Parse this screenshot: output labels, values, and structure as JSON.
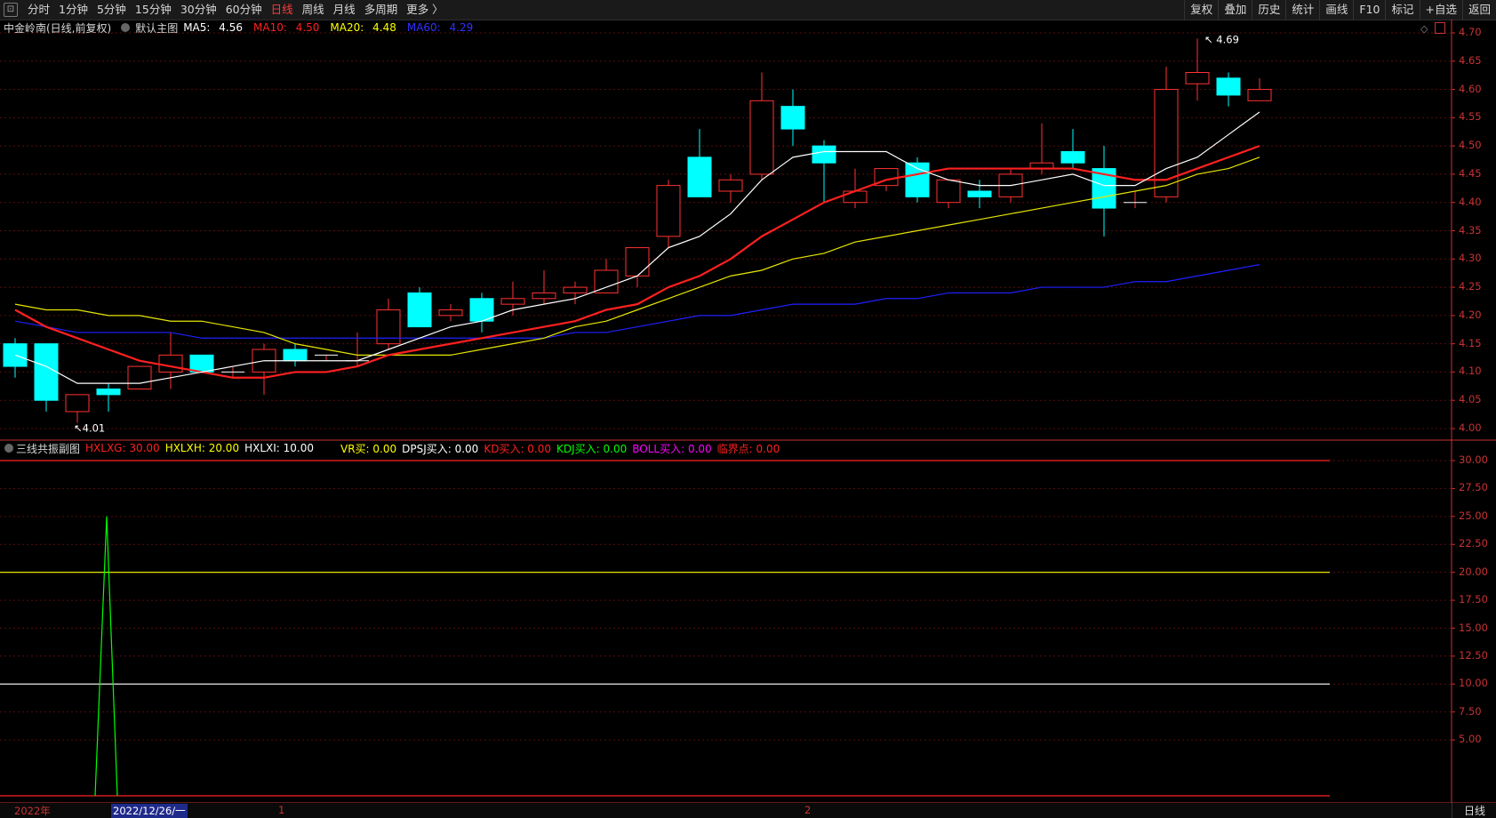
{
  "toolbar": {
    "periods": [
      "分时",
      "1分钟",
      "5分钟",
      "15分钟",
      "30分钟",
      "60分钟",
      "日线",
      "周线",
      "月线",
      "多周期",
      "更多 〉"
    ],
    "active_period": "日线",
    "tools": [
      "复权",
      "叠加",
      "历史",
      "统计",
      "画线",
      "F10",
      "标记",
      "+自选",
      "返回"
    ]
  },
  "main_chart": {
    "stock_name": "中金岭南(日线,前复权)",
    "template_name": "默认主图",
    "ma5": {
      "label": "MA5:",
      "value": "4.56",
      "color": "#ffffff"
    },
    "ma10": {
      "label": "MA10:",
      "value": "4.50",
      "color": "#ff2020"
    },
    "ma20": {
      "label": "MA20:",
      "value": "4.48",
      "color": "#ffff00"
    },
    "ma60": {
      "label": "MA60:",
      "value": "4.29",
      "color": "#2020ff"
    },
    "price_ticks": [
      "4.70",
      "4.65",
      "4.60",
      "4.55",
      "4.50",
      "4.45",
      "4.40",
      "4.35",
      "4.30",
      "4.25",
      "4.20",
      "4.15",
      "4.10",
      "4.05",
      "4.00"
    ],
    "high_label": "4.69",
    "low_label": "4.01"
  },
  "sub_chart": {
    "indicator_name": "三线共振副图",
    "legend": [
      {
        "label": "HXLXG:",
        "value": "30.00",
        "color": "#ff2020"
      },
      {
        "label": "HXLXH:",
        "value": "20.00",
        "color": "#ffff00"
      },
      {
        "label": "HXLXI:",
        "value": "10.00",
        "color": "#ffffff"
      },
      {
        "label": "VR买:",
        "value": "0.00",
        "color": "#ffff00"
      },
      {
        "label": "DPSJ买入:",
        "value": "0.00",
        "color": "#ffffff"
      },
      {
        "label": "KD买入:",
        "value": "0.00",
        "color": "#ff2020"
      },
      {
        "label": "KDJ买入:",
        "value": "0.00",
        "color": "#00ff00"
      },
      {
        "label": "BOLL买入:",
        "value": "0.00",
        "color": "#ff00ff"
      },
      {
        "label": "临界点:",
        "value": "0.00",
        "color": "#ff2020"
      }
    ],
    "ticks": [
      "30.00",
      "27.50",
      "25.00",
      "22.50",
      "20.00",
      "17.50",
      "15.00",
      "12.50",
      "10.00",
      "7.50",
      "5.00"
    ]
  },
  "bottom": {
    "year_label": "2022年",
    "selected_date": "2022/12/26/一",
    "month_1": "1",
    "month_2": "2",
    "period_tag": "日线"
  },
  "chart_data": [
    {
      "type": "candlestick",
      "title": "中金岭南(日线,前复权)",
      "ylim": [
        4.0,
        4.7
      ],
      "candles": [
        {
          "o": 4.15,
          "h": 4.16,
          "l": 4.09,
          "c": 4.11
        },
        {
          "o": 4.15,
          "h": 4.15,
          "l": 4.03,
          "c": 4.05
        },
        {
          "o": 4.03,
          "h": 4.06,
          "l": 4.01,
          "c": 4.06
        },
        {
          "o": 4.07,
          "h": 4.08,
          "l": 4.03,
          "c": 4.06
        },
        {
          "o": 4.07,
          "h": 4.11,
          "l": 4.07,
          "c": 4.11
        },
        {
          "o": 4.1,
          "h": 4.17,
          "l": 4.07,
          "c": 4.13
        },
        {
          "o": 4.13,
          "h": 4.13,
          "l": 4.1,
          "c": 4.1
        },
        {
          "o": 4.1,
          "h": 4.11,
          "l": 4.09,
          "c": 4.1
        },
        {
          "o": 4.1,
          "h": 4.15,
          "l": 4.06,
          "c": 4.14
        },
        {
          "o": 4.14,
          "h": 4.15,
          "l": 4.11,
          "c": 4.12
        },
        {
          "o": 4.13,
          "h": 4.13,
          "l": 4.12,
          "c": 4.13
        },
        {
          "o": 4.12,
          "h": 4.17,
          "l": 4.11,
          "c": 4.12
        },
        {
          "o": 4.15,
          "h": 4.23,
          "l": 4.14,
          "c": 4.21
        },
        {
          "o": 4.24,
          "h": 4.25,
          "l": 4.18,
          "c": 4.18
        },
        {
          "o": 4.2,
          "h": 4.22,
          "l": 4.19,
          "c": 4.21
        },
        {
          "o": 4.23,
          "h": 4.24,
          "l": 4.17,
          "c": 4.19
        },
        {
          "o": 4.22,
          "h": 4.26,
          "l": 4.2,
          "c": 4.23
        },
        {
          "o": 4.23,
          "h": 4.28,
          "l": 4.22,
          "c": 4.24
        },
        {
          "o": 4.24,
          "h": 4.26,
          "l": 4.22,
          "c": 4.25
        },
        {
          "o": 4.24,
          "h": 4.3,
          "l": 4.24,
          "c": 4.28
        },
        {
          "o": 4.27,
          "h": 4.32,
          "l": 4.25,
          "c": 4.32
        },
        {
          "o": 4.34,
          "h": 4.44,
          "l": 4.32,
          "c": 4.43
        },
        {
          "o": 4.48,
          "h": 4.53,
          "l": 4.41,
          "c": 4.41
        },
        {
          "o": 4.42,
          "h": 4.45,
          "l": 4.4,
          "c": 4.44
        },
        {
          "o": 4.45,
          "h": 4.63,
          "l": 4.44,
          "c": 4.58
        },
        {
          "o": 4.57,
          "h": 4.6,
          "l": 4.5,
          "c": 4.53
        },
        {
          "o": 4.5,
          "h": 4.51,
          "l": 4.4,
          "c": 4.47
        },
        {
          "o": 4.4,
          "h": 4.46,
          "l": 4.39,
          "c": 4.42
        },
        {
          "o": 4.43,
          "h": 4.46,
          "l": 4.42,
          "c": 4.46
        },
        {
          "o": 4.47,
          "h": 4.48,
          "l": 4.4,
          "c": 4.41
        },
        {
          "o": 4.4,
          "h": 4.44,
          "l": 4.39,
          "c": 4.44
        },
        {
          "o": 4.42,
          "h": 4.44,
          "l": 4.39,
          "c": 4.41
        },
        {
          "o": 4.41,
          "h": 4.46,
          "l": 4.4,
          "c": 4.45
        },
        {
          "o": 4.46,
          "h": 4.54,
          "l": 4.45,
          "c": 4.47
        },
        {
          "o": 4.49,
          "h": 4.53,
          "l": 4.46,
          "c": 4.47
        },
        {
          "o": 4.46,
          "h": 4.5,
          "l": 4.34,
          "c": 4.39
        },
        {
          "o": 4.4,
          "h": 4.42,
          "l": 4.39,
          "c": 4.4
        },
        {
          "o": 4.41,
          "h": 4.64,
          "l": 4.4,
          "c": 4.6
        },
        {
          "o": 4.61,
          "h": 4.69,
          "l": 4.58,
          "c": 4.63
        },
        {
          "o": 4.62,
          "h": 4.63,
          "l": 4.57,
          "c": 4.59
        },
        {
          "o": 4.58,
          "h": 4.62,
          "l": 4.58,
          "c": 4.6
        }
      ],
      "ma5": [
        4.13,
        4.11,
        4.08,
        4.08,
        4.08,
        4.09,
        4.1,
        4.11,
        4.12,
        4.12,
        4.12,
        4.12,
        4.14,
        4.16,
        4.18,
        4.19,
        4.21,
        4.22,
        4.23,
        4.25,
        4.27,
        4.32,
        4.34,
        4.38,
        4.44,
        4.48,
        4.49,
        4.49,
        4.49,
        4.46,
        4.44,
        4.43,
        4.43,
        4.44,
        4.45,
        4.43,
        4.43,
        4.46,
        4.48,
        4.52,
        4.56
      ],
      "ma10": [
        4.21,
        4.18,
        4.16,
        4.14,
        4.12,
        4.11,
        4.1,
        4.09,
        4.09,
        4.1,
        4.1,
        4.11,
        4.13,
        4.14,
        4.15,
        4.16,
        4.17,
        4.18,
        4.19,
        4.21,
        4.22,
        4.25,
        4.27,
        4.3,
        4.34,
        4.37,
        4.4,
        4.42,
        4.44,
        4.45,
        4.46,
        4.46,
        4.46,
        4.46,
        4.46,
        4.45,
        4.44,
        4.44,
        4.46,
        4.48,
        4.5
      ],
      "ma20": [
        4.22,
        4.21,
        4.21,
        4.2,
        4.2,
        4.19,
        4.19,
        4.18,
        4.17,
        4.15,
        4.14,
        4.13,
        4.13,
        4.13,
        4.13,
        4.14,
        4.15,
        4.16,
        4.18,
        4.19,
        4.21,
        4.23,
        4.25,
        4.27,
        4.28,
        4.3,
        4.31,
        4.33,
        4.34,
        4.35,
        4.36,
        4.37,
        4.38,
        4.39,
        4.4,
        4.41,
        4.42,
        4.43,
        4.45,
        4.46,
        4.48
      ],
      "ma60": [
        4.19,
        4.18,
        4.17,
        4.17,
        4.17,
        4.17,
        4.16,
        4.16,
        4.16,
        4.16,
        4.16,
        4.16,
        4.16,
        4.16,
        4.16,
        4.16,
        4.16,
        4.16,
        4.17,
        4.17,
        4.18,
        4.19,
        4.2,
        4.2,
        4.21,
        4.22,
        4.22,
        4.22,
        4.23,
        4.23,
        4.24,
        4.24,
        4.24,
        4.25,
        4.25,
        4.25,
        4.26,
        4.26,
        4.27,
        4.28,
        4.29
      ]
    },
    {
      "type": "line",
      "title": "三线共振副图",
      "ylim": [
        0,
        30
      ],
      "hlines": [
        {
          "name": "HXLXG",
          "value": 30,
          "color": "#ff2020"
        },
        {
          "name": "HXLXH",
          "value": 20,
          "color": "#ffff00"
        },
        {
          "name": "HXLXI",
          "value": 10,
          "color": "#ffffff"
        }
      ],
      "spike": {
        "name": "临界点",
        "color": "#00ff00",
        "values": [
          0,
          0,
          0,
          25,
          0,
          0,
          0,
          0,
          0,
          0,
          0,
          0,
          0,
          0,
          0,
          0,
          0,
          0,
          0,
          0,
          0,
          0,
          0,
          0,
          0,
          0,
          0,
          0,
          0,
          0,
          0,
          0,
          0,
          0,
          0,
          0,
          0,
          0,
          0,
          0,
          0
        ]
      }
    }
  ]
}
